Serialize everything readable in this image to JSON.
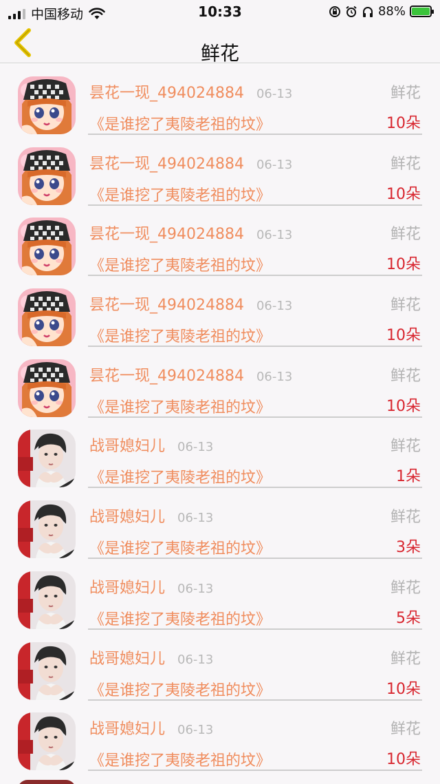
{
  "status_bar": {
    "carrier": "中国移动",
    "time": "10:33",
    "battery": "88%"
  },
  "nav": {
    "title": "鲜花"
  },
  "rows": [
    {
      "name": "昙花一现_494024884",
      "date": "06-13",
      "type": "鲜花",
      "book": "《是谁挖了夷陵老祖的坟》",
      "count": "10朵",
      "avatar": "anime-girl"
    },
    {
      "name": "昙花一现_494024884",
      "date": "06-13",
      "type": "鲜花",
      "book": "《是谁挖了夷陵老祖的坟》",
      "count": "10朵",
      "avatar": "anime-girl"
    },
    {
      "name": "昙花一现_494024884",
      "date": "06-13",
      "type": "鲜花",
      "book": "《是谁挖了夷陵老祖的坟》",
      "count": "10朵",
      "avatar": "anime-girl"
    },
    {
      "name": "昙花一现_494024884",
      "date": "06-13",
      "type": "鲜花",
      "book": "《是谁挖了夷陵老祖的坟》",
      "count": "10朵",
      "avatar": "anime-girl"
    },
    {
      "name": "昙花一现_494024884",
      "date": "06-13",
      "type": "鲜花",
      "book": "《是谁挖了夷陵老祖的坟》",
      "count": "10朵",
      "avatar": "anime-girl"
    },
    {
      "name": "战哥媳妇儿",
      "date": "06-13",
      "type": "鲜花",
      "book": "《是谁挖了夷陵老祖的坟》",
      "count": "1朵",
      "avatar": "photo-man"
    },
    {
      "name": "战哥媳妇儿",
      "date": "06-13",
      "type": "鲜花",
      "book": "《是谁挖了夷陵老祖的坟》",
      "count": "3朵",
      "avatar": "photo-man"
    },
    {
      "name": "战哥媳妇儿",
      "date": "06-13",
      "type": "鲜花",
      "book": "《是谁挖了夷陵老祖的坟》",
      "count": "5朵",
      "avatar": "photo-man"
    },
    {
      "name": "战哥媳妇儿",
      "date": "06-13",
      "type": "鲜花",
      "book": "《是谁挖了夷陵老祖的坟》",
      "count": "10朵",
      "avatar": "photo-man"
    },
    {
      "name": "战哥媳妇儿",
      "date": "06-13",
      "type": "鲜花",
      "book": "《是谁挖了夷陵老祖的坟》",
      "count": "10朵",
      "avatar": "photo-man"
    }
  ],
  "colors": {
    "name": "#f08d5e",
    "count": "#d8262f",
    "muted": "#b3b3b3",
    "back_arrow": "#e6c400"
  }
}
